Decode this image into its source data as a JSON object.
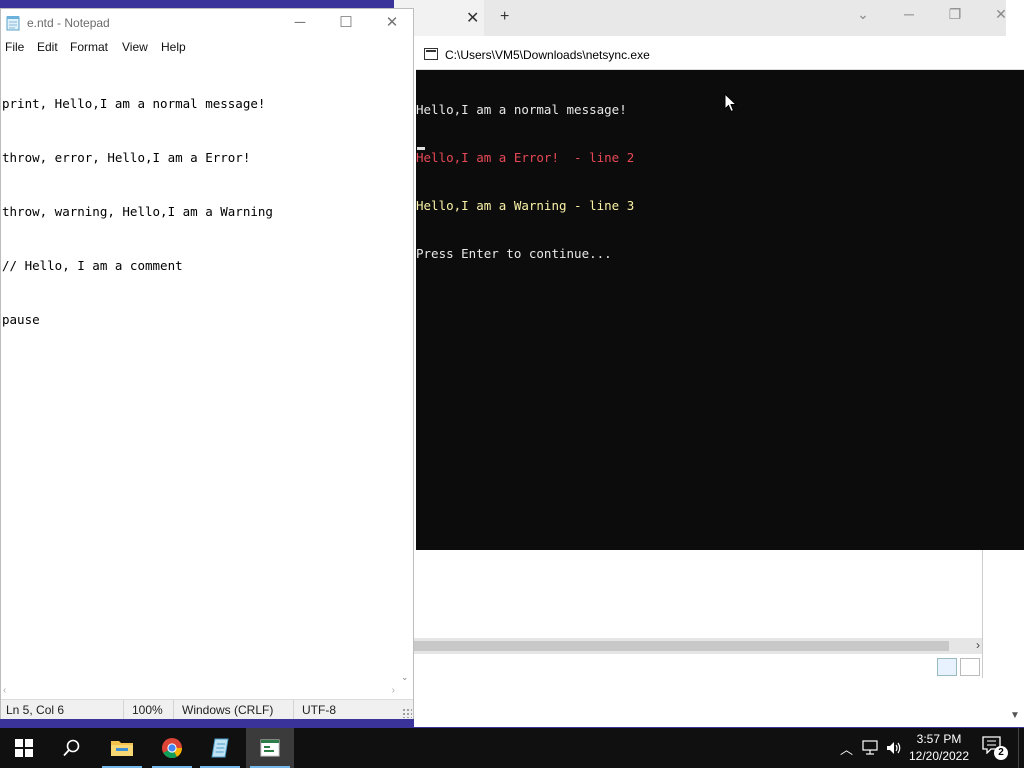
{
  "notepad": {
    "title": "e.ntd - Notepad",
    "menu": [
      "File",
      "Edit",
      "Format",
      "View",
      "Help"
    ],
    "lines": [
      "print, Hello,I am a normal message!",
      "throw, error, Hello,I am a Error!",
      "throw, warning, Hello,I am a Warning",
      "// Hello, I am a comment",
      "pause"
    ],
    "status": {
      "position": "Ln 5, Col 6",
      "zoom": "100%",
      "line_ending": "Windows (CRLF)",
      "encoding": "UTF-8"
    }
  },
  "console": {
    "title": "C:\\Users\\VM5\\Downloads\\netsync.exe",
    "lines": [
      {
        "text": "Hello,I am a normal message!",
        "color": "#e8e8e8"
      },
      {
        "text": "Hello,I am a Error!  - line 2",
        "color": "#e74856"
      },
      {
        "text": "Hello,I am a Warning - line 3",
        "color": "#f9f1a5"
      },
      {
        "text": "Press Enter to continue...",
        "color": "#e8e8e8"
      }
    ]
  },
  "taskbar": {
    "clock_time": "3:57 PM",
    "clock_date": "12/20/2022",
    "notification_count": "2",
    "apps": [
      "start-icon",
      "search-icon",
      "file-explorer-icon",
      "chrome-icon",
      "notepad-icon",
      "console-app-icon"
    ]
  },
  "colors": {
    "desktop": "#3a3399",
    "taskbar": "#101010",
    "console_bg": "#0c0c0c",
    "error_text": "#e74856",
    "warning_text": "#f9f1a5",
    "taskbar_accent": "#76b9ed"
  }
}
